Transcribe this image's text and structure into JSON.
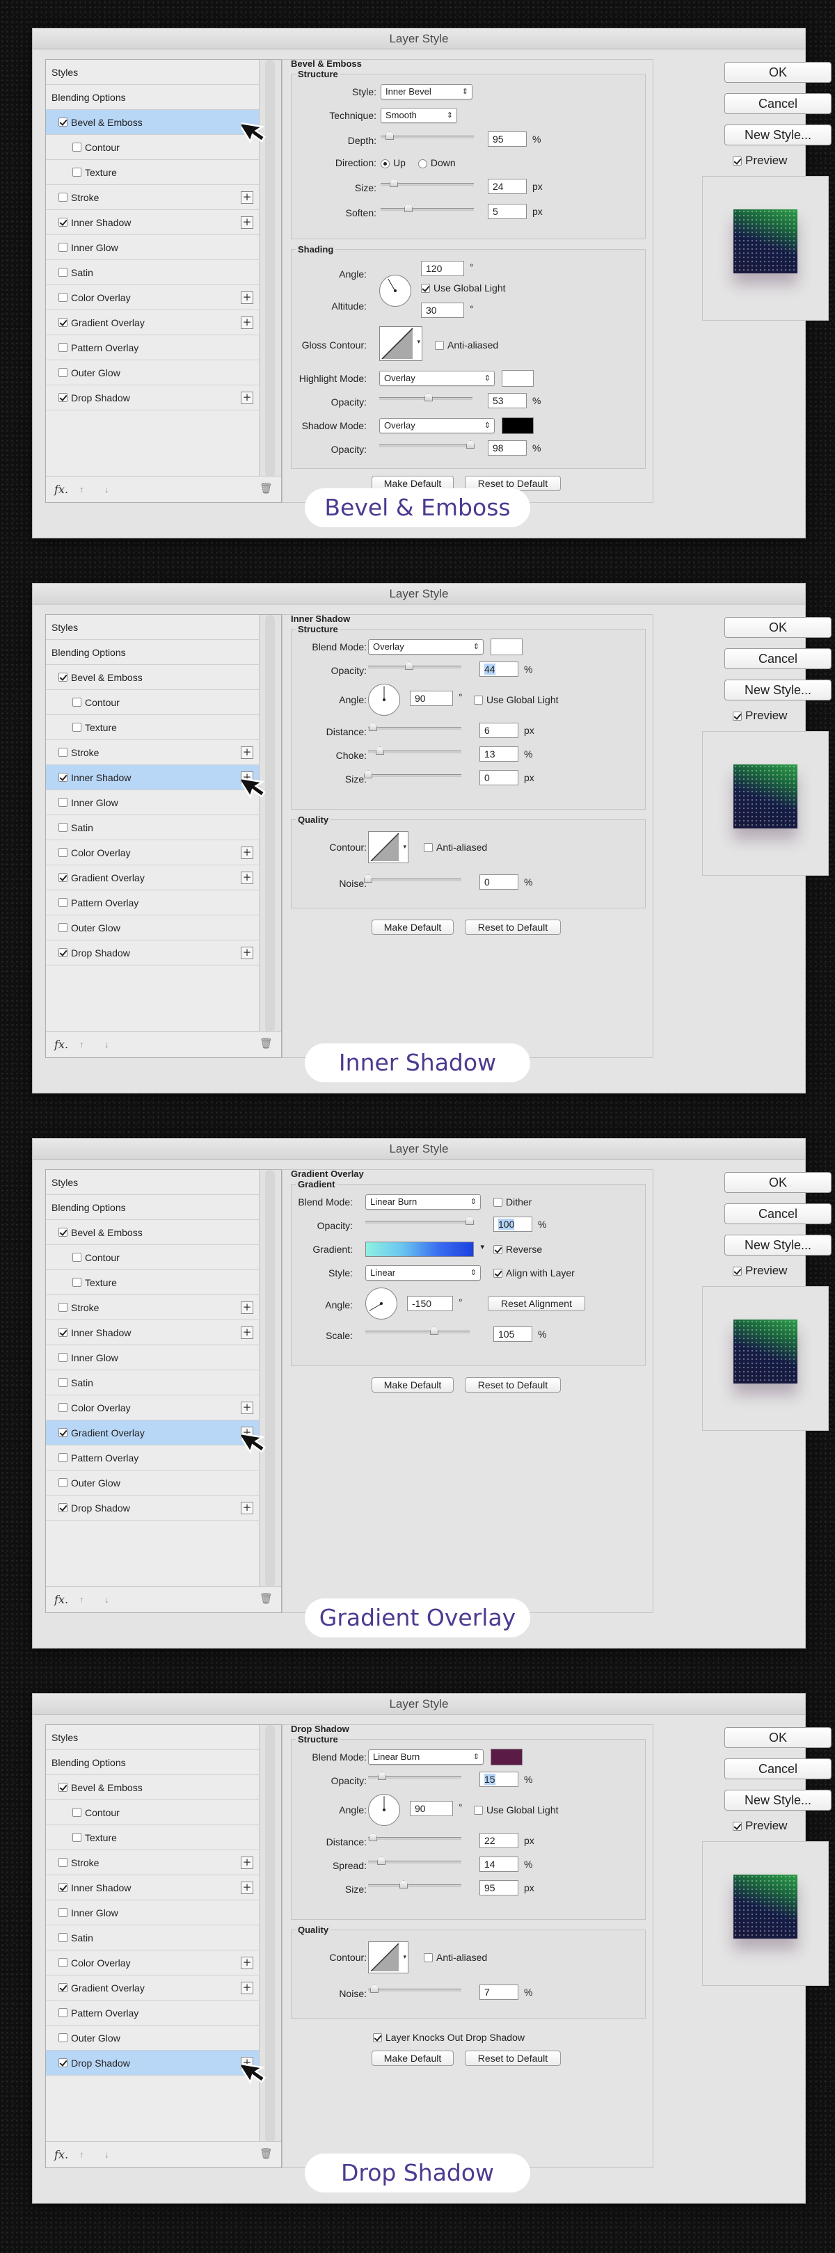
{
  "common": {
    "title": "Layer Style",
    "styles_list": [
      "Styles",
      "Blending Options",
      "Bevel & Emboss",
      "Contour",
      "Texture",
      "Stroke",
      "Inner Shadow",
      "Inner Glow",
      "Satin",
      "Color Overlay",
      "Gradient Overlay",
      "Pattern Overlay",
      "Outer Glow",
      "Drop Shadow"
    ],
    "checked": [
      false,
      false,
      true,
      false,
      false,
      false,
      true,
      false,
      false,
      false,
      true,
      false,
      false,
      true
    ],
    "ok": "OK",
    "cancel": "Cancel",
    "new_style": "New Style...",
    "preview": "Preview",
    "make_default": "Make Default",
    "reset_default": "Reset to Default",
    "fx": "fx.",
    "arrow_up": "↑",
    "arrow_down": "↓",
    "trash": "🗑"
  },
  "panel1": {
    "caption": "Bevel & Emboss",
    "section": "Bevel & Emboss",
    "sub1": "Structure",
    "style_label": "Style:",
    "style_value": "Inner Bevel",
    "technique_label": "Technique:",
    "technique_value": "Smooth",
    "depth_label": "Depth:",
    "depth_value": "95",
    "depth_unit": "%",
    "direction_label": "Direction:",
    "dir_up": "Up",
    "dir_down": "Down",
    "size_label": "Size:",
    "size_value": "24",
    "size_unit": "px",
    "soften_label": "Soften:",
    "soften_value": "5",
    "soften_unit": "px",
    "sub2": "Shading",
    "angle_label": "Angle:",
    "angle_value": "120",
    "deg": "°",
    "global_light": "Use Global Light",
    "altitude_label": "Altitude:",
    "altitude_value": "30",
    "gloss_label": "Gloss Contour:",
    "anti": "Anti-aliased",
    "hmode_label": "Highlight Mode:",
    "hmode_value": "Overlay",
    "hopacity_label": "Opacity:",
    "hopacity_value": "53",
    "pct": "%",
    "smode_label": "Shadow Mode:",
    "smode_value": "Overlay",
    "sopacity_label": "Opacity:",
    "sopacity_value": "98"
  },
  "panel2": {
    "caption": "Inner Shadow",
    "section": "Inner Shadow",
    "sub1": "Structure",
    "blend_label": "Blend Mode:",
    "blend_value": "Overlay",
    "opacity_label": "Opacity:",
    "opacity_value": "44",
    "pct": "%",
    "angle_label": "Angle:",
    "angle_value": "90",
    "deg": "°",
    "global_light": "Use Global Light",
    "distance_label": "Distance:",
    "distance_value": "6",
    "px": "px",
    "choke_label": "Choke:",
    "choke_value": "13",
    "size_label": "Size:",
    "size_value": "0",
    "sub2": "Quality",
    "contour_label": "Contour:",
    "anti": "Anti-aliased",
    "noise_label": "Noise:",
    "noise_value": "0"
  },
  "panel3": {
    "caption": "Gradient Overlay",
    "section": "Gradient Overlay",
    "sub1": "Gradient",
    "blend_label": "Blend Mode:",
    "blend_value": "Linear Burn",
    "dither": "Dither",
    "opacity_label": "Opacity:",
    "opacity_value": "100",
    "pct": "%",
    "gradient_label": "Gradient:",
    "reverse": "Reverse",
    "style_label": "Style:",
    "style_value": "Linear",
    "align": "Align with Layer",
    "angle_label": "Angle:",
    "angle_value": "-150",
    "deg": "°",
    "reset_align": "Reset Alignment",
    "scale_label": "Scale:",
    "scale_value": "105"
  },
  "panel4": {
    "caption": "Drop Shadow",
    "section": "Drop Shadow",
    "sub1": "Structure",
    "blend_label": "Blend Mode:",
    "blend_value": "Linear Burn",
    "opacity_label": "Opacity:",
    "opacity_value": "15",
    "pct": "%",
    "angle_label": "Angle:",
    "angle_value": "90",
    "deg": "°",
    "global_light": "Use Global Light",
    "distance_label": "Distance:",
    "distance_value": "22",
    "px": "px",
    "spread_label": "Spread:",
    "spread_value": "14",
    "pctsp": "%",
    "size_label": "Size:",
    "size_value": "95",
    "sub2": "Quality",
    "contour_label": "Contour:",
    "anti": "Anti-aliased",
    "noise_label": "Noise:",
    "noise_value": "7",
    "knockout": "Layer Knocks Out Drop Shadow"
  },
  "colors": {
    "highlight_swatch": "#ffffff",
    "shadow_swatch": "#000000",
    "inner_shadow_swatch": "#ffffff",
    "drop_shadow_swatch": "#5a1c47",
    "caption_text": "#4e3a91",
    "selected_row": "#b8d6f6"
  }
}
